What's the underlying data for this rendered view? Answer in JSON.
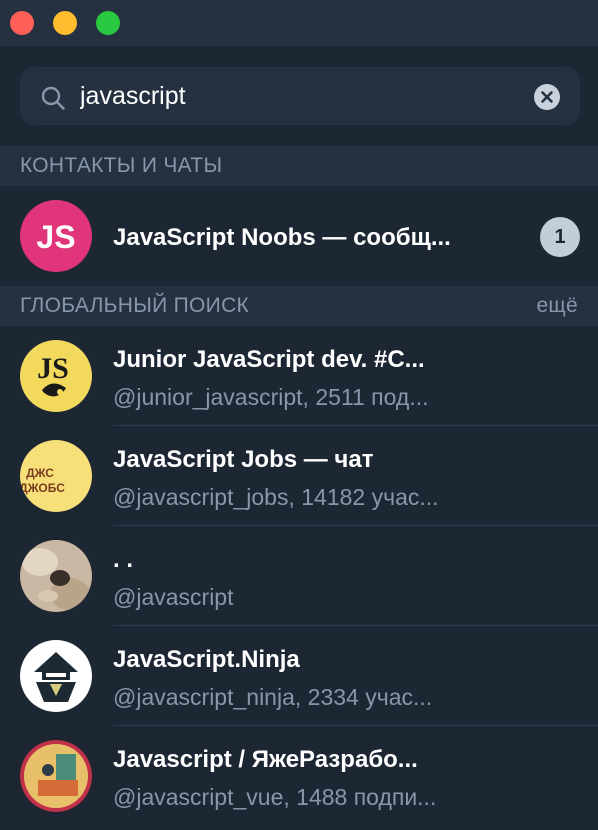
{
  "window": {
    "controls": [
      "close",
      "minimize",
      "maximize"
    ]
  },
  "search": {
    "value": "javascript",
    "icon": "search-icon",
    "clear_icon": "clear-icon"
  },
  "sections": {
    "contacts_header": "КОНТАКТЫ И ЧАТЫ",
    "global_header": "ГЛОБАЛЬНЫЙ ПОИСК",
    "global_more": "ещё"
  },
  "contacts": [
    {
      "title": "JavaScript Noobs — сообщ...",
      "avatar_text": "JS",
      "avatar_color": "#e0357a",
      "unread": "1"
    }
  ],
  "global_results": [
    {
      "title": "Junior JavaScript dev. #C...",
      "subtitle": "@junior_javascript, 2511 под...",
      "avatar_color": "#f2d95c"
    },
    {
      "title": "JavaScript Jobs — чат",
      "subtitle": "@javascript_jobs, 14182 учас...",
      "avatar_text_1": "ДЖС",
      "avatar_text_2": "ДЖОБС",
      "avatar_color": "#f7e07a"
    },
    {
      "title": ". .",
      "subtitle": "@javascript",
      "avatar_color": "#c8b8a4"
    },
    {
      "title": "JavaScript.Ninja",
      "subtitle": "@javascript_ninja, 2334 учас...",
      "avatar_color": "#ffffff"
    },
    {
      "title": "Javascript / ЯжеРазрабо...",
      "subtitle": "@javascript_vue, 1488 подпи...",
      "avatar_color": "#e8c06a"
    }
  ]
}
